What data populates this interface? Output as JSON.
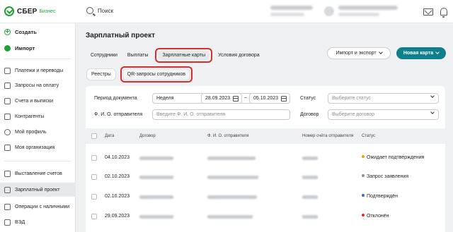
{
  "brand": {
    "name": "СБЕР",
    "suffix": "Бизнес",
    "color": "#21a038"
  },
  "topbar": {
    "search_label": "Поиск"
  },
  "sidebar": {
    "items": [
      {
        "label": "Создать",
        "icon": "plus-circle-icon"
      },
      {
        "label": "Импорт",
        "icon": "import-icon"
      },
      {
        "label": "Платежи и переводы",
        "icon": "payments-icon"
      },
      {
        "label": "Запросы на оплату",
        "icon": "requests-icon"
      },
      {
        "label": "Счета и выписки",
        "icon": "accounts-icon"
      },
      {
        "label": "Контрагенты",
        "icon": "counterparties-icon"
      },
      {
        "label": "Мой профиль",
        "icon": "profile-icon"
      },
      {
        "label": "Моя организация",
        "icon": "organization-icon"
      },
      {
        "label": "Выставление счетов",
        "icon": "invoice-icon"
      },
      {
        "label": "Зарплатный проект",
        "icon": "salary-icon",
        "active": true
      },
      {
        "label": "Операции с наличными",
        "icon": "cash-icon"
      },
      {
        "label": "ВЭД",
        "icon": "ved-icon"
      }
    ]
  },
  "main": {
    "title": "Зарплатный проект",
    "tabs": [
      {
        "label": "Сотрудники"
      },
      {
        "label": "Выплаты"
      },
      {
        "label": "Зарплатные карты",
        "selected": true
      },
      {
        "label": "Условия договора"
      }
    ],
    "import_export_label": "Импорт и экспорт",
    "new_card_label": "Новая карта",
    "subtabs": [
      {
        "label": "Реестры"
      },
      {
        "label": "QR-запросы сотрудников",
        "selected": true
      }
    ]
  },
  "filters": {
    "period_label": "Период документа",
    "period_value": "Неделя",
    "date_from": "28.09.2023",
    "date_sep": "–",
    "date_to": "05.10.2023",
    "status_label": "Статус",
    "status_placeholder": "Выберите статус",
    "sender_label": "Ф. И. О. отправителя",
    "sender_placeholder": "Введите Ф. И. О. отправителя",
    "contract_label": "Договор",
    "contract_placeholder": "Выберите договор"
  },
  "table": {
    "columns": [
      "Дата",
      "Договор",
      "Ф. И. О. отправителя",
      "Номер счёта отправителя",
      "Статус"
    ],
    "rows": [
      {
        "date": "04.10.2023",
        "status": "Ожидает подтверждения",
        "status_color": "#f0a500"
      },
      {
        "date": "02.10.2023",
        "status": "Запрос заявления",
        "status_color": "#8a9099"
      },
      {
        "date": "02.10.2023",
        "status": "Подтверждён",
        "status_color": "#2f6fd8"
      },
      {
        "date": "29.09.2023",
        "status": "Отклонён",
        "status_color": "#d32f2f"
      }
    ]
  },
  "highlight_color": "#d32f2f",
  "accent_color": "#107f8c"
}
